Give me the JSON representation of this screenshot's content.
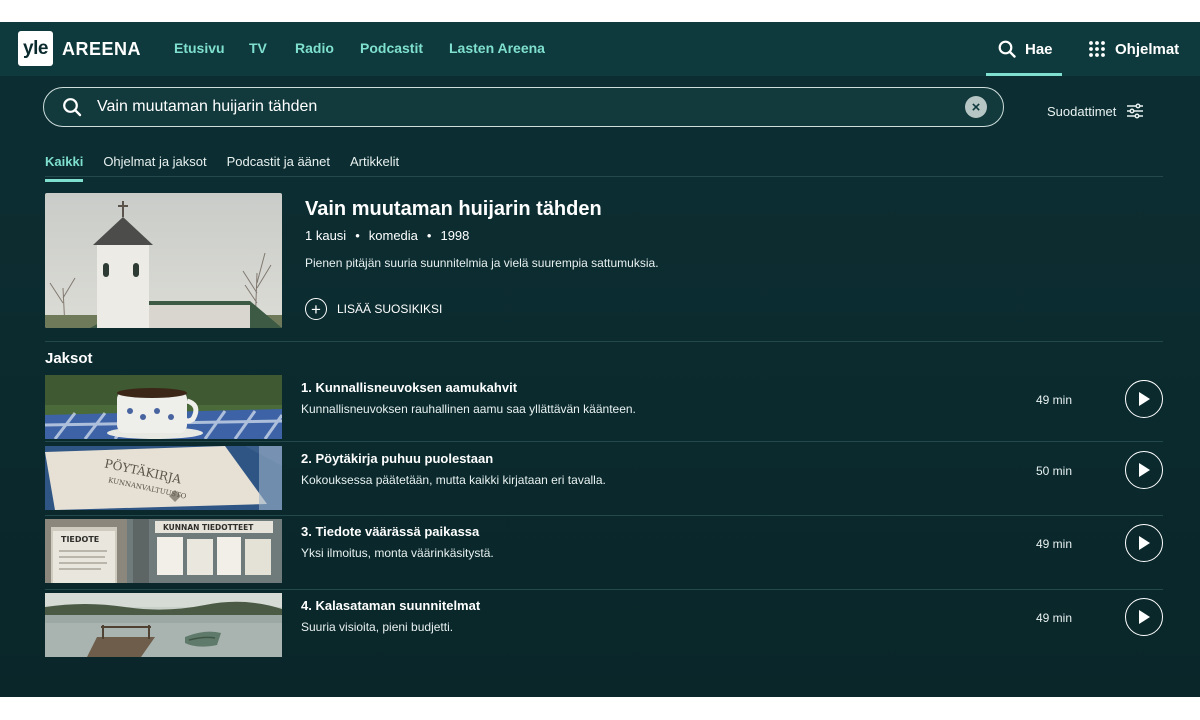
{
  "brand": {
    "logo": "yle",
    "name": "AREENA"
  },
  "nav": {
    "items": [
      "Etusivu",
      "TV",
      "Radio",
      "Podcastit",
      "Lasten Areena"
    ],
    "search_label": "Hae",
    "programs_label": "Ohjelmat",
    "icons": {
      "search": "search-icon",
      "programs": "grid-icon"
    }
  },
  "search": {
    "value": "Vain muutaman huijarin tähden",
    "filters_label": "Suodattimet"
  },
  "tabs": [
    "Kaikki",
    "Ohjelmat ja jaksot",
    "Podcastit ja äänet",
    "Artikkelit"
  ],
  "active_tab": "Kaikki",
  "result": {
    "title": "Vain muutaman huijarin tähden",
    "seasons": "1 kausi",
    "genre": "komedia",
    "year": "1998",
    "description": "Pienen pitäjän suuria suunnitelmia ja vielä suurempia sattumuksia.",
    "favorite_label": "LISÄÄ SUOSIKIKSI",
    "image": "church-icon"
  },
  "episodes_heading": "Jaksot",
  "episodes": [
    {
      "title": "1. Kunnallisneuvoksen aamukahvit",
      "description": "Kunnallisneuvoksen rauhallinen aamu saa yllättävän käänteen.",
      "duration": "49 min",
      "image": "coffee-cup"
    },
    {
      "title": "2. Pöytäkirja puhuu puolestaan",
      "description": "Kokouksessa päätetään, mutta kaikki kirjataan eri tavalla.",
      "duration": "50 min",
      "image": "binder",
      "image_text": [
        "PÖYTÄKIRJA",
        "KUNNANVALTUUSTO"
      ]
    },
    {
      "title": "3. Tiedote väärässä paikassa",
      "description": "Yksi ilmoitus, monta väärinkäsitystä.",
      "duration": "49 min",
      "image": "notice-board",
      "image_text": [
        "TIEDOTE",
        "KUNNAN TIEDOTTEET"
      ]
    },
    {
      "title": "4. Kalasataman suunnitelmat",
      "description": "Suuria visioita, pieni budjetti.",
      "duration": "49 min",
      "image": "lake-pier"
    }
  ],
  "colors": {
    "background": "#0b2a2e",
    "topbar": "#0f3a3d",
    "accent": "#7fe0cf"
  }
}
